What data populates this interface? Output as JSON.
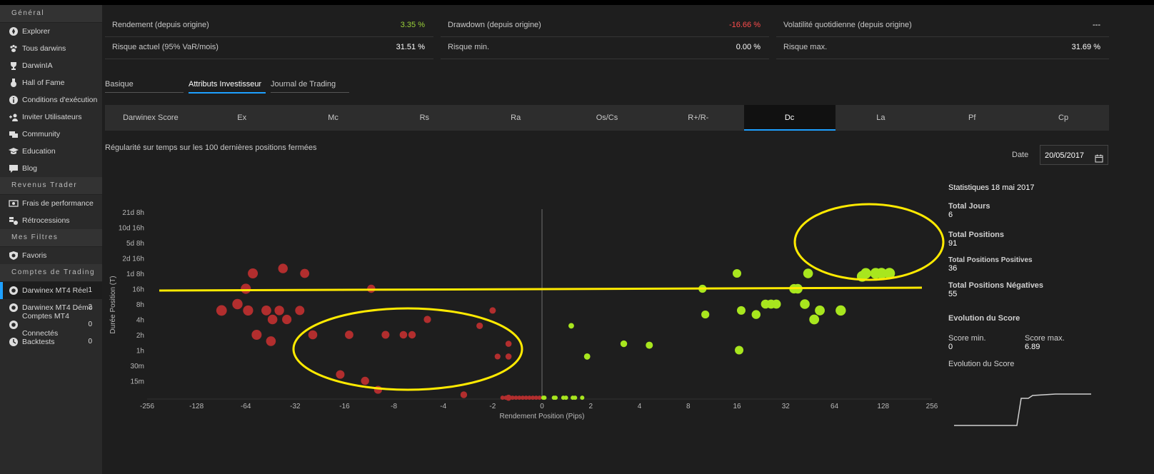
{
  "sidebar": {
    "sections": [
      {
        "title": "Général",
        "items": [
          {
            "label": "Explorer",
            "icon": "compass-icon"
          },
          {
            "label": "Tous darwins",
            "icon": "paw-icon"
          },
          {
            "label": "DarwinIA",
            "icon": "trophy-icon"
          },
          {
            "label": "Hall of Fame",
            "icon": "medal-icon"
          },
          {
            "label": "Conditions d'exécution",
            "icon": "info-icon"
          },
          {
            "label": "Inviter Utilisateurs",
            "icon": "add-user-icon"
          },
          {
            "label": "Community",
            "icon": "chat-icon"
          },
          {
            "label": "Education",
            "icon": "graduation-cap-icon"
          },
          {
            "label": "Blog",
            "icon": "comment-icon"
          }
        ]
      },
      {
        "title": "Revenus Trader",
        "items": [
          {
            "label": "Frais de performance",
            "icon": "money-icon"
          },
          {
            "label": "Rétrocessions",
            "icon": "retro-icon"
          }
        ]
      },
      {
        "title": "Mes Filtres",
        "items": [
          {
            "label": "Favoris",
            "icon": "shield-icon"
          }
        ]
      },
      {
        "title": "Comptes de Trading",
        "items": [
          {
            "label": "Darwinex MT4 Réel",
            "count": "1",
            "icon": "circle-dot-icon",
            "active": true
          },
          {
            "label": "Darwinex MT4 Démo",
            "count": "2",
            "icon": "circle-dot-icon"
          },
          {
            "label": "Comptes MT4 Connectés",
            "count": "0",
            "icon": "circle-dot-icon"
          },
          {
            "label": "Backtests",
            "count": "0",
            "icon": "backtest-icon"
          }
        ]
      }
    ]
  },
  "stats": {
    "row1": [
      {
        "label": "Rendement (depuis origine)",
        "value": "3.35 %",
        "color": "#9bd33a"
      },
      {
        "label": "Drawdown (depuis origine)",
        "value": "-16.66 %",
        "color": "#ff4d4d"
      },
      {
        "label": "Volatilité quotidienne (depuis origine)",
        "value": "---",
        "color": "#ffffff"
      }
    ],
    "row2": [
      {
        "label": "Risque actuel (95% VaR/mois)",
        "value": "31.51 %",
        "color": "#ffffff"
      },
      {
        "label": "Risque min.",
        "value": "0.00 %",
        "color": "#ffffff"
      },
      {
        "label": "Risque max.",
        "value": "31.69 %",
        "color": "#ffffff"
      }
    ]
  },
  "tabs": [
    "Basique",
    "Attributs Investisseur",
    "Journal de Trading"
  ],
  "active_tab": "Attributs Investisseur",
  "attr_tabs": [
    "Darwinex Score",
    "Ex",
    "Mc",
    "Rs",
    "Ra",
    "Os/Cs",
    "R+/R-",
    "Dc",
    "La",
    "Pf",
    "Cp"
  ],
  "active_attr_tab": "Dc",
  "subtitle": "Régularité sur temps sur les 100 dernières positions fermées",
  "date": {
    "label": "Date",
    "value": "20/05/2017"
  },
  "stats_panel": {
    "title": "Statistiques 18 mai 2017",
    "total_jours_label": "Total Jours",
    "total_jours": "6",
    "total_positions_label": "Total Positions",
    "total_positions": "91",
    "pos_label": "Total Positions Positives",
    "pos": "36",
    "neg_label": "Total Positions Négatives",
    "neg": "55",
    "evo_label": "Evolution du Score",
    "score_min_label": "Score min.",
    "score_min": "0",
    "score_max_label": "Score max.",
    "score_max": "6.89",
    "evo_label2": "Evolution du Score"
  },
  "chart_data": {
    "type": "scatter",
    "xlabel": "Rendement Position (Pips)",
    "ylabel": "Durée Position (T)",
    "x_ticks": [
      "-256",
      "-128",
      "-64",
      "-32",
      "-16",
      "-8",
      "-4",
      "-2",
      "0",
      "2",
      "4",
      "8",
      "16",
      "32",
      "64",
      "128",
      "256"
    ],
    "y_ticks": [
      "21d 8h",
      "10d 16h",
      "5d 8h",
      "2d 16h",
      "1d 8h",
      "16h",
      "8h",
      "4h",
      "2h",
      "1h",
      "30m",
      "15m"
    ],
    "colors": {
      "negative": "#b22e2e",
      "positive": "#a8e61e",
      "axis_line": "#555555",
      "annotation": "#ffea00"
    },
    "negative_points": [
      {
        "x": -64,
        "y": "16h"
      },
      {
        "x": -58,
        "y": "1d 8h"
      },
      {
        "x": -72,
        "y": "8h"
      },
      {
        "x": -90,
        "y": "6h"
      },
      {
        "x": -62,
        "y": "6h"
      },
      {
        "x": -48,
        "y": "6h"
      },
      {
        "x": -40,
        "y": "6h"
      },
      {
        "x": -36,
        "y": "4h"
      },
      {
        "x": -44,
        "y": "4h"
      },
      {
        "x": -30,
        "y": "6h"
      },
      {
        "x": -28,
        "y": "1d 8h"
      },
      {
        "x": -38,
        "y": "1d 16h"
      },
      {
        "x": -55,
        "y": "2h"
      },
      {
        "x": -45,
        "y": "1h 30m"
      },
      {
        "x": -25,
        "y": "2h"
      },
      {
        "x": -11,
        "y": "16h"
      },
      {
        "x": -15,
        "y": "2h"
      },
      {
        "x": -9,
        "y": "2h"
      },
      {
        "x": -7,
        "y": "2h"
      },
      {
        "x": -6.2,
        "y": "2h"
      },
      {
        "x": -5,
        "y": "4h"
      },
      {
        "x": -17,
        "y": "20m"
      },
      {
        "x": -12,
        "y": "15m"
      },
      {
        "x": -10,
        "y": "10m"
      },
      {
        "x": -2.4,
        "y": "3h"
      },
      {
        "x": -2,
        "y": "6h"
      },
      {
        "x": -1.6,
        "y": "1h 20m"
      },
      {
        "x": -1.6,
        "y": "45m"
      },
      {
        "x": -0.9,
        "y": "45m"
      },
      {
        "x": -3,
        "y": "8m"
      },
      {
        "x": -1.6,
        "y": "7m"
      }
    ],
    "negative_zero_cluster": {
      "x_from": -0.8,
      "x_to": -0.05,
      "count": 12,
      "y": "7m"
    },
    "positive_points": [
      {
        "x": 0.6,
        "y": "3h"
      },
      {
        "x": 1.9,
        "y": "45m"
      },
      {
        "x": 3.2,
        "y": "1h 20m"
      },
      {
        "x": 4.6,
        "y": "1h 15m"
      },
      {
        "x": 9.8,
        "y": "16h"
      },
      {
        "x": 10.2,
        "y": "5h"
      },
      {
        "x": 16,
        "y": "1d 8h"
      },
      {
        "x": 17,
        "y": "6h"
      },
      {
        "x": 21,
        "y": "5h"
      },
      {
        "x": 16.5,
        "y": "1h"
      },
      {
        "x": 24,
        "y": "8h"
      },
      {
        "x": 26,
        "y": "8h"
      },
      {
        "x": 28,
        "y": "8h"
      },
      {
        "x": 36,
        "y": "16h"
      },
      {
        "x": 38,
        "y": "16h"
      },
      {
        "x": 42,
        "y": "8h"
      },
      {
        "x": 44,
        "y": "1d 8h"
      },
      {
        "x": 48,
        "y": "4h"
      },
      {
        "x": 52,
        "y": "6h"
      },
      {
        "x": 70,
        "y": "6h"
      },
      {
        "x": 95,
        "y": "1d 4h"
      },
      {
        "x": 100,
        "y": "1d 8h"
      },
      {
        "x": 115,
        "y": "1d 8h"
      },
      {
        "x": 125,
        "y": "1d 8h"
      },
      {
        "x": 140,
        "y": "1d 8h"
      }
    ],
    "positive_zero_cluster": {
      "x_from": 0.05,
      "x_to": 1.6,
      "count": 9,
      "y": "7m"
    }
  }
}
